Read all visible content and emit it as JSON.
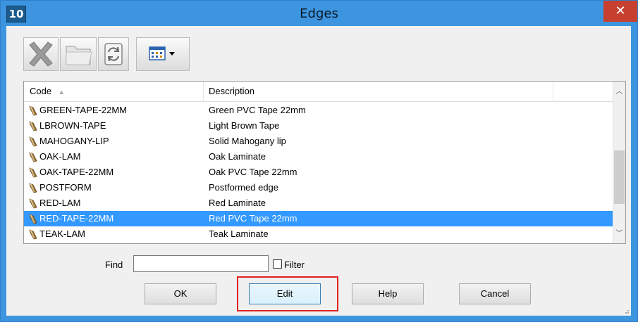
{
  "window": {
    "app_icon_text": "10",
    "title": "Edges",
    "close_glyph": "✕"
  },
  "toolbar": {
    "buttons": [
      "delete-icon",
      "folder-icon",
      "refresh-icon",
      "view-columns-icon"
    ]
  },
  "list": {
    "headers": {
      "code": "Code",
      "description": "Description",
      "sort_indicator": "▲"
    },
    "rows": [
      {
        "code": "GREEN-TAPE-22MM",
        "description": "Green PVC Tape 22mm",
        "selected": false
      },
      {
        "code": "LBROWN-TAPE",
        "description": "Light Brown Tape",
        "selected": false
      },
      {
        "code": "MAHOGANY-LIP",
        "description": "Solid Mahogany lip",
        "selected": false
      },
      {
        "code": "OAK-LAM",
        "description": "Oak Laminate",
        "selected": false
      },
      {
        "code": "OAK-TAPE-22MM",
        "description": "Oak PVC Tape 22mm",
        "selected": false
      },
      {
        "code": "POSTFORM",
        "description": "Postformed edge",
        "selected": false
      },
      {
        "code": "RED-LAM",
        "description": "Red Laminate",
        "selected": false
      },
      {
        "code": "RED-TAPE-22MM",
        "description": "Red PVC Tape 22mm",
        "selected": true
      },
      {
        "code": "TEAK-LAM",
        "description": "Teak Laminate",
        "selected": false
      }
    ]
  },
  "find": {
    "label": "Find",
    "value": "",
    "filter_label": "Filter",
    "filter_checked": false
  },
  "buttons": {
    "ok": "OK",
    "edit": "Edit",
    "help": "Help",
    "cancel": "Cancel"
  },
  "colors": {
    "selection": "#3399ff",
    "title_bar": "#3d95e0",
    "close": "#c7402f",
    "highlight": "#e02020"
  }
}
